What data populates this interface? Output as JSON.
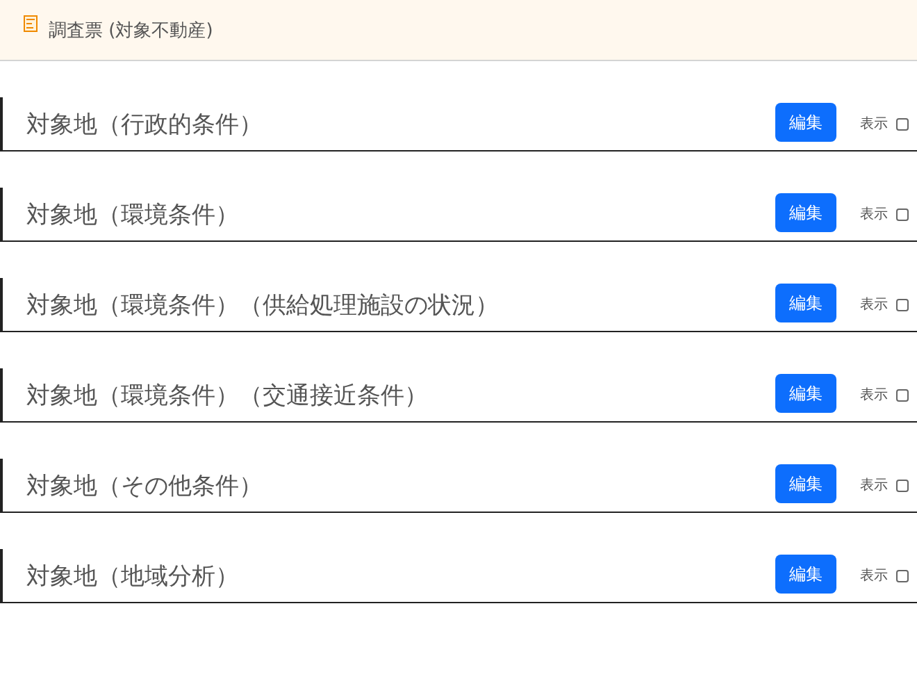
{
  "header": {
    "title": "調査票 (対象不動産)"
  },
  "sections": [
    {
      "title": "対象地（行政的条件）",
      "button": "編集",
      "toggle_label": "表示",
      "checked": false
    },
    {
      "title": "対象地（環境条件）",
      "button": "編集",
      "toggle_label": "表示",
      "checked": false
    },
    {
      "title": "対象地（環境条件）（供給処理施設の状況）",
      "button": "編集",
      "toggle_label": "表示",
      "checked": false
    },
    {
      "title": "対象地（環境条件）（交通接近条件）",
      "button": "編集",
      "toggle_label": "表示",
      "checked": false
    },
    {
      "title": "対象地（その他条件）",
      "button": "編集",
      "toggle_label": "表示",
      "checked": false
    },
    {
      "title": "対象地（地域分析）",
      "button": "編集",
      "toggle_label": "表示",
      "checked": false
    }
  ]
}
